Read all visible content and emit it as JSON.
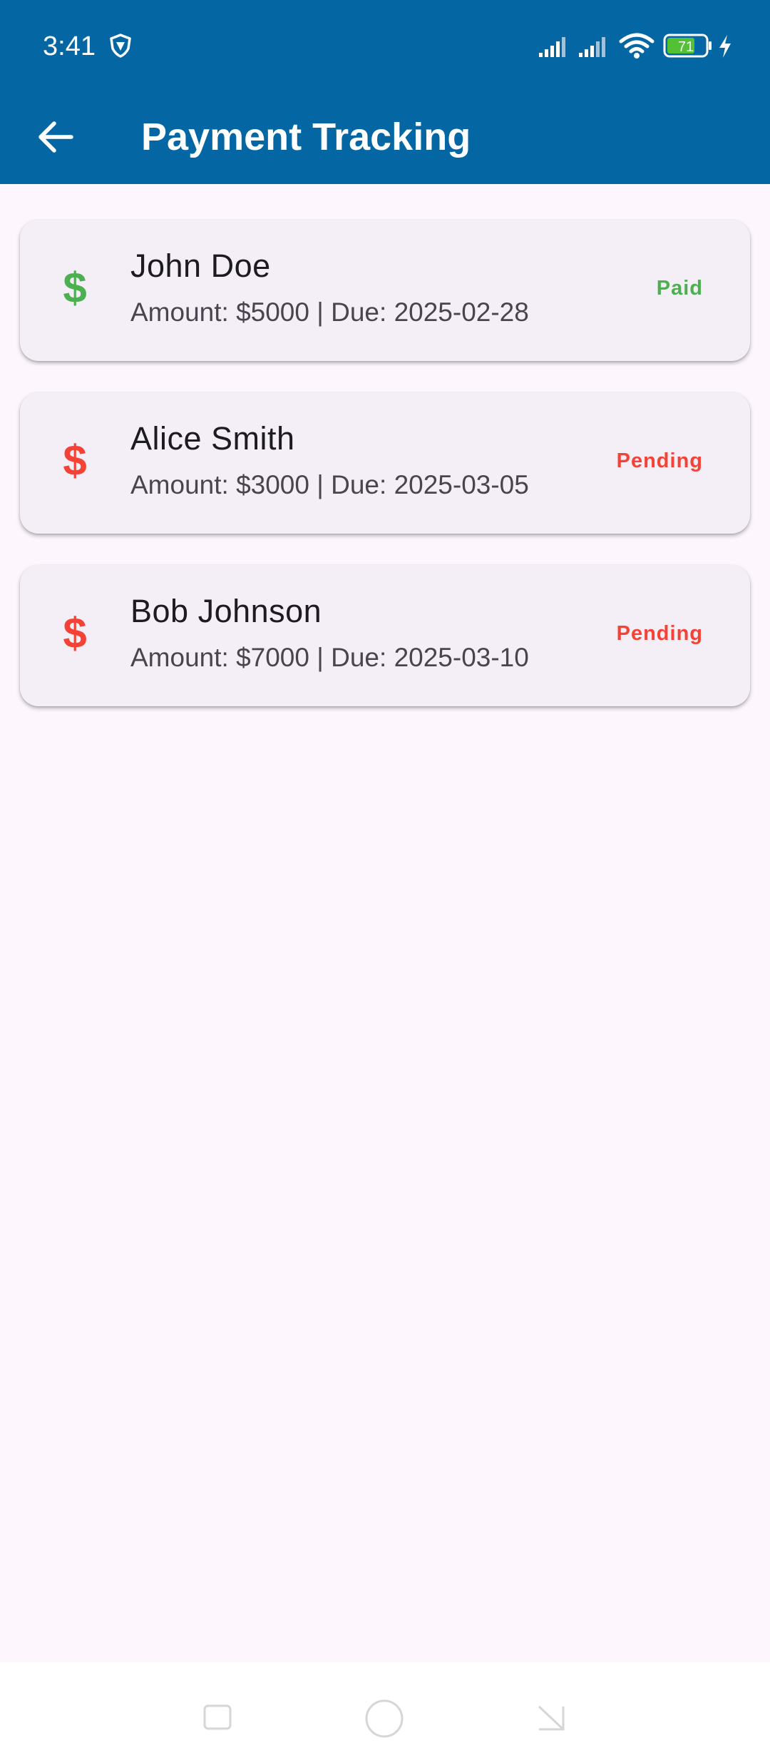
{
  "status_bar": {
    "time": "3:41",
    "battery_level": "71",
    "icons": [
      "vpn-shield-icon",
      "cell-signal-icon",
      "cell-signal-icon",
      "wifi-icon",
      "battery-icon",
      "charging-icon"
    ]
  },
  "app_bar": {
    "title": "Payment Tracking",
    "back_icon": "arrow-back-icon",
    "background_color": "#0467a4"
  },
  "payments": [
    {
      "name": "John Doe",
      "subtitle": "Amount: $5000 | Due: 2025-02-28",
      "status": "Paid",
      "status_color": "#4caf50",
      "icon": "dollar-icon"
    },
    {
      "name": "Alice Smith",
      "subtitle": "Amount: $3000 | Due: 2025-03-05",
      "status": "Pending",
      "status_color": "#f44336",
      "icon": "dollar-icon"
    },
    {
      "name": "Bob Johnson",
      "subtitle": "Amount: $7000 | Due: 2025-03-10",
      "status": "Pending",
      "status_color": "#f44336",
      "icon": "dollar-icon"
    }
  ],
  "nav_bar": {
    "buttons": [
      "recents-square-icon",
      "home-circle-icon",
      "back-triangle-icon"
    ]
  },
  "colors": {
    "page_background": "#fdf7fd",
    "card_background": "#f4eff6",
    "paid": "#4caf50",
    "pending": "#f44336"
  }
}
